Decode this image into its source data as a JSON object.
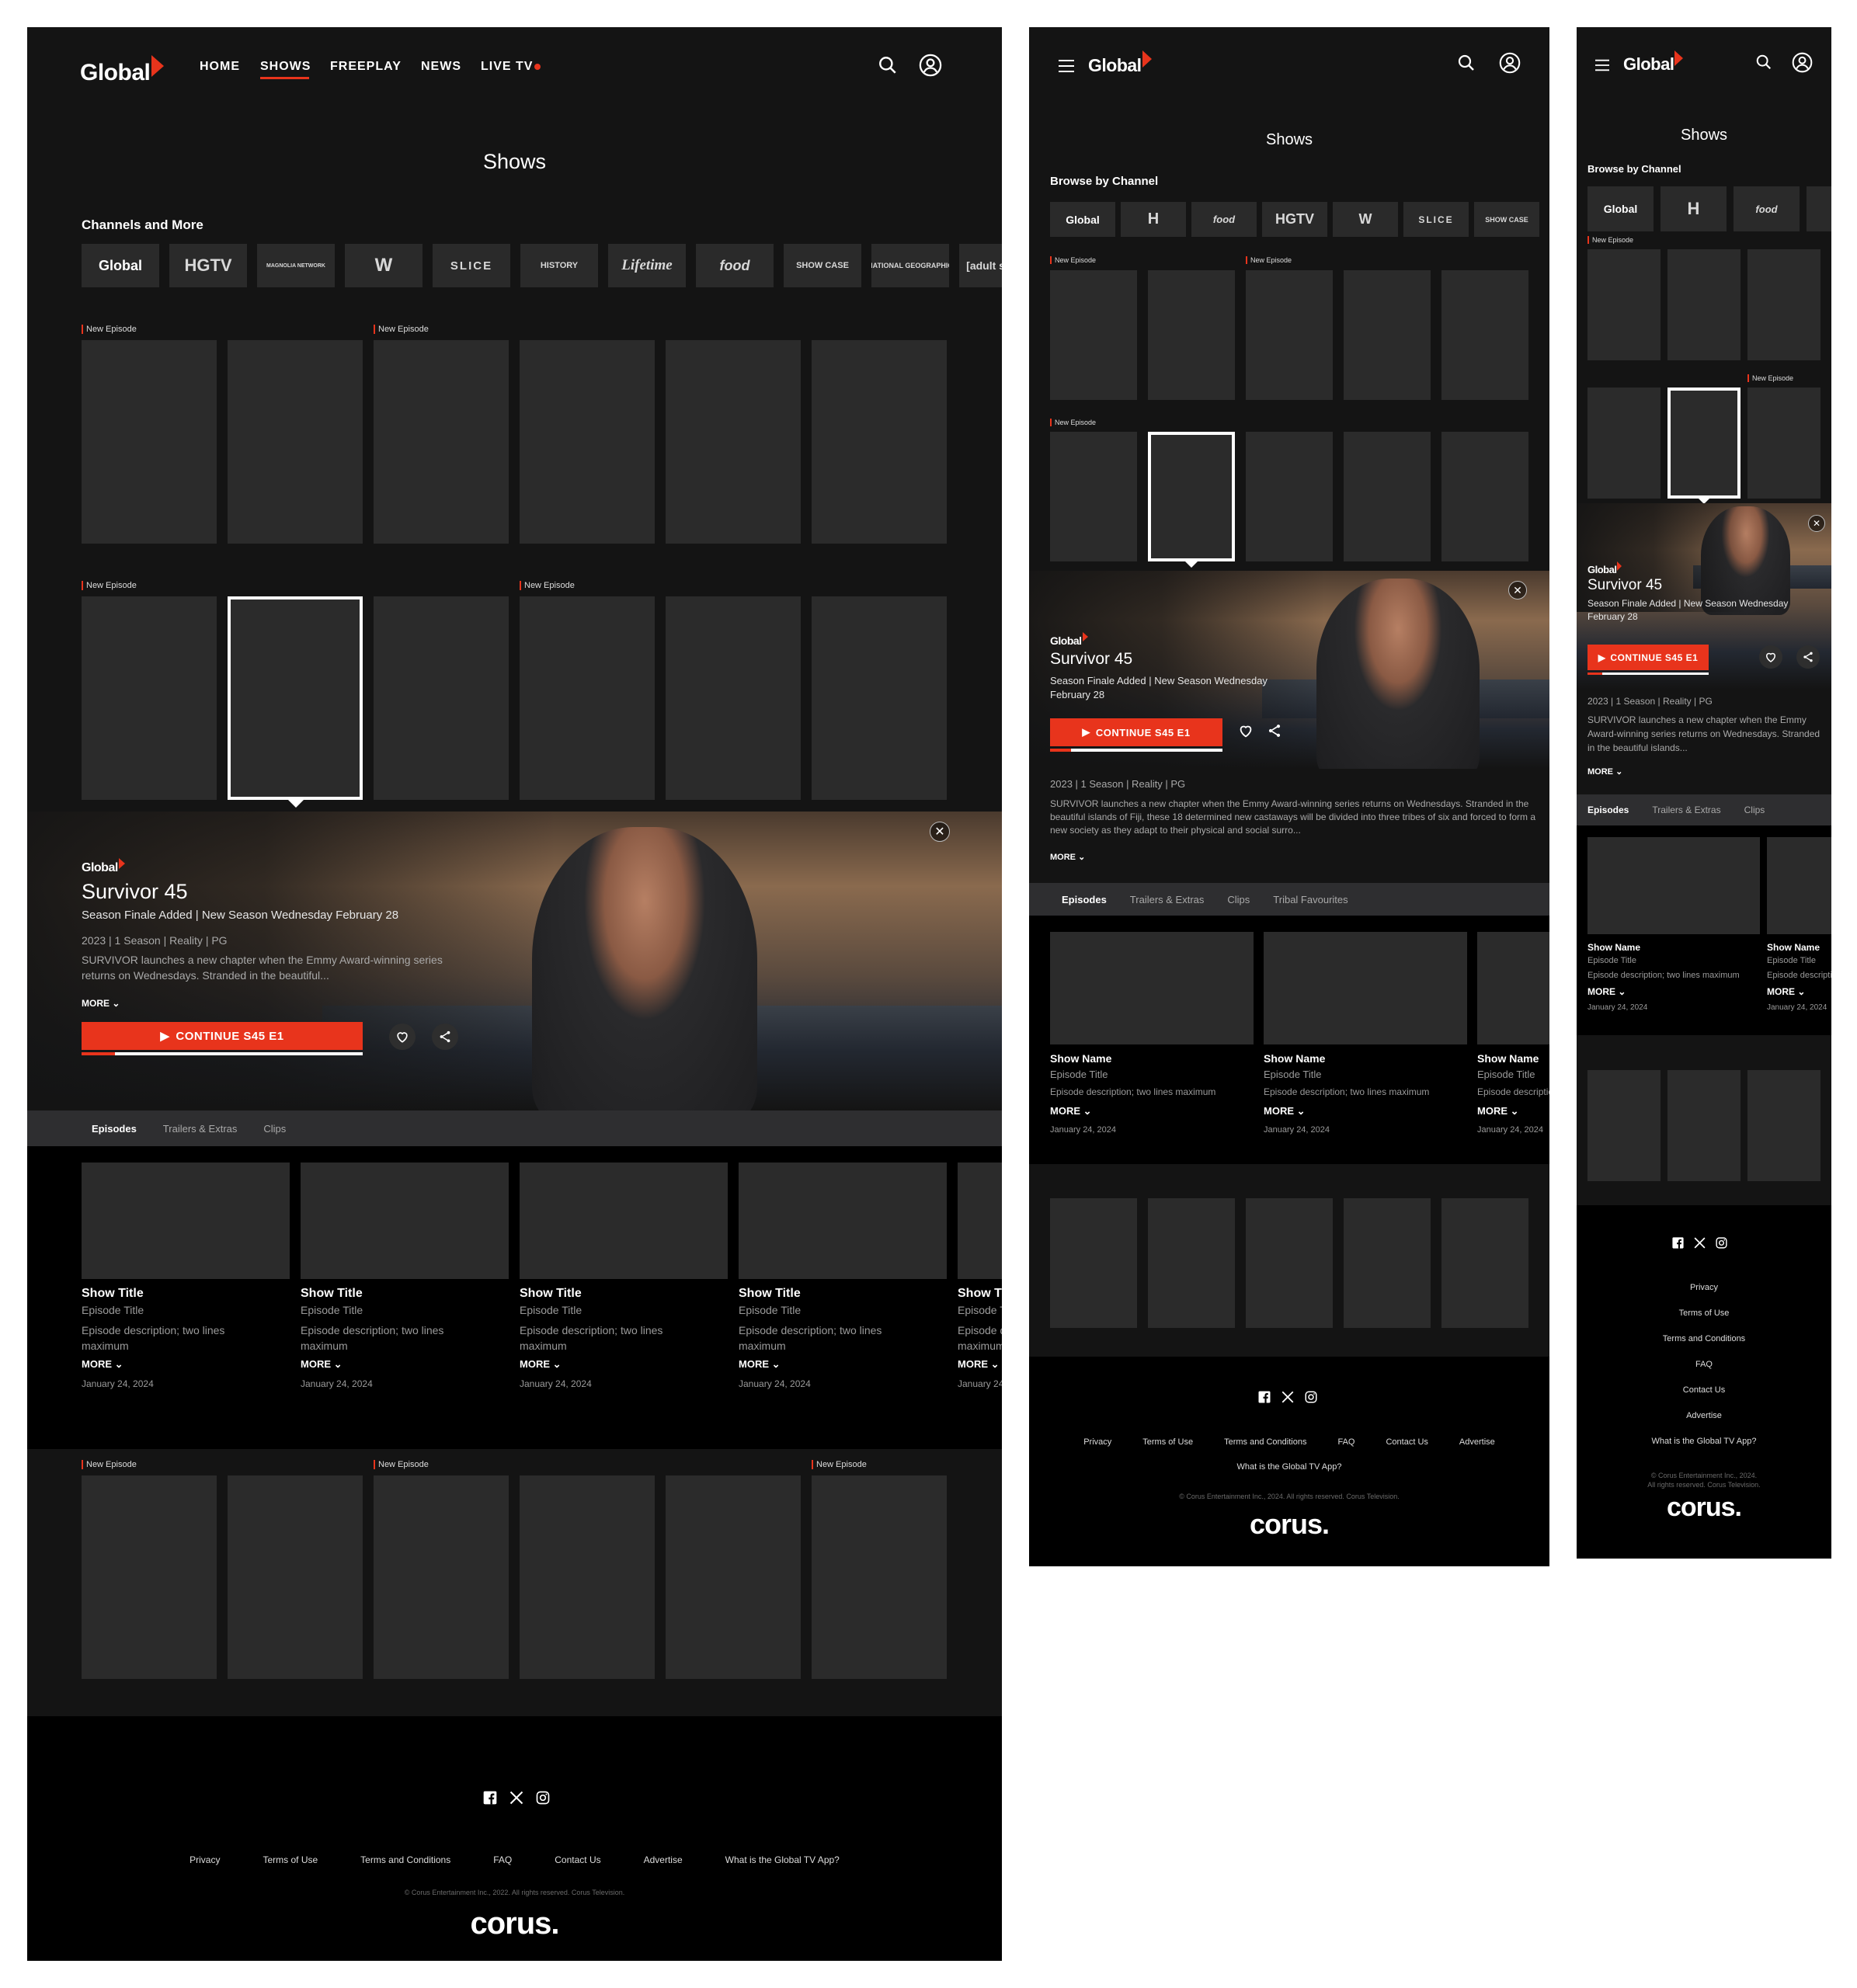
{
  "brand": {
    "logo": "Global",
    "accent": "#e8341c",
    "bg": "#141414"
  },
  "nav": {
    "home": "HOME",
    "shows": "SHOWS",
    "freeplay": "FREEPLAY",
    "news": "NEWS",
    "live": "LIVE TV"
  },
  "page": {
    "title": "Shows",
    "channels_heading": "Channels and More",
    "browse_heading": "Browse by Channel"
  },
  "channels": [
    "Global",
    "HGTV",
    "MAGNOLIA NETWORK",
    "W",
    "SLICE",
    "HISTORY",
    "Lifetime",
    "food",
    "SHOW CASE",
    "NATIONAL GEOGRAPHIC",
    "[adult swim]"
  ],
  "channels_tablet": [
    "Global",
    "H",
    "food",
    "HGTV",
    "W",
    "SLICE",
    "SHOW CASE"
  ],
  "channels_mobile": [
    "Global",
    "H",
    "food",
    "H"
  ],
  "badge": "New Episode",
  "hero": {
    "network": "Global",
    "title": "Survivor 45",
    "subtitle": "Season Finale Added | New Season Wednesday February 28",
    "subtitle_line1": "Season Finale Added | New Season Wednesday",
    "subtitle_line2": "February 28",
    "meta": "2023 | 1 Season | Reality | PG",
    "desc_short": "SURVIVOR launches a new chapter when the Emmy Award-winning series returns on Wednesdays. Stranded in the beautiful...",
    "desc_long": "SURVIVOR launches a new chapter when the Emmy Award-winning series returns on Wednesdays. Stranded in the beautiful islands of Fiji, these 18 determined new castaways will be divided into three tribes of six and forced to form a new society as they adapt to their physical and social surro...",
    "desc_mobile": "SURVIVOR launches a new chapter when the Emmy Award-winning series returns on Wednesdays. Stranded in the beautiful islands...",
    "more": "MORE",
    "cta": "CONTINUE S45 E1",
    "progress": 0.12
  },
  "tabs": {
    "episodes": "Episodes",
    "trailers": "Trailers & Extras",
    "clips": "Clips",
    "tribal": "Tribal Favourites"
  },
  "episode_desktop": {
    "show": "Show Title",
    "ep": "Episode Title",
    "desc": "Episode description; two lines maximum",
    "more": "MORE",
    "date": "January 24, 2024"
  },
  "episode_small": {
    "show": "Show Name",
    "ep": "Episode Title",
    "desc": "Episode description; two lines maximum",
    "more": "MORE",
    "date": "January 24, 2024"
  },
  "footer": {
    "links": [
      "Privacy",
      "Terms of Use",
      "Terms and Conditions",
      "FAQ",
      "Contact Us",
      "Advertise",
      "What is the Global TV App?"
    ],
    "copy_2022": "© Corus Entertainment Inc., 2022. All rights reserved. Corus Television.",
    "copy_2024": "© Corus Entertainment Inc., 2024. All rights reserved. Corus Television.",
    "copy_2024_a": "© Corus Entertainment Inc., 2024.",
    "copy_2024_b": "All rights reserved. Corus Television.",
    "corus": "corus."
  },
  "icons": [
    "search-icon",
    "account-icon",
    "menu-icon",
    "close-icon",
    "heart-icon",
    "share-icon",
    "play-icon",
    "chevron-down-icon",
    "facebook-icon",
    "x-icon",
    "instagram-icon"
  ]
}
